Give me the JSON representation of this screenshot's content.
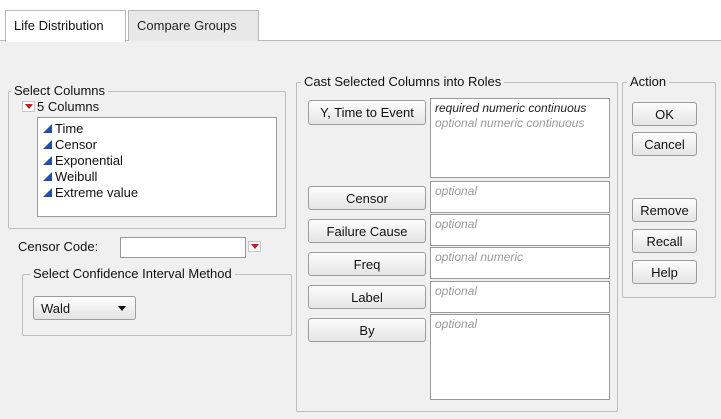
{
  "tabs": [
    {
      "label": "Life Distribution",
      "active": true
    },
    {
      "label": "Compare Groups",
      "active": false
    }
  ],
  "select_columns": {
    "title": "Select Columns",
    "count_label": "5 Columns",
    "columns": [
      "Time",
      "Censor",
      "Exponential",
      "Weibull",
      "Extreme value"
    ]
  },
  "censor_code": {
    "label": "Censor Code:",
    "value": ""
  },
  "ci_method": {
    "title": "Select Confidence Interval Method",
    "selected": "Wald"
  },
  "roles": {
    "title": "Cast Selected Columns into Roles",
    "items": [
      {
        "button": "Y, Time to Event",
        "hints": [
          "required numeric continuous",
          "optional numeric continuous"
        ]
      },
      {
        "button": "Censor",
        "hints": [
          "optional"
        ]
      },
      {
        "button": "Failure Cause",
        "hints": [
          "optional"
        ]
      },
      {
        "button": "Freq",
        "hints": [
          "optional numeric"
        ]
      },
      {
        "button": "Label",
        "hints": [
          "optional"
        ]
      },
      {
        "button": "By",
        "hints": [
          "optional"
        ]
      }
    ]
  },
  "action": {
    "title": "Action",
    "buttons": [
      "OK",
      "Cancel",
      "Remove",
      "Recall",
      "Help"
    ]
  },
  "colors": {
    "accent_red": "#cc1a1a",
    "continuous_icon": "#1f4fa8"
  }
}
